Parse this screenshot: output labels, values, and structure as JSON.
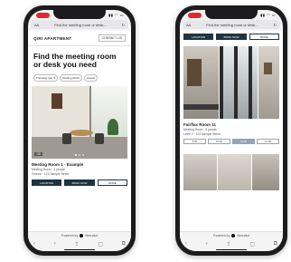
{
  "left_phone": {
    "url": "Find the meeting room or desk...",
    "status_icons": "▮▮ ◠ ▭",
    "brand": "QIRI APARTMENT",
    "contact_label": "CONTACT US",
    "hero_title": "Find the meeting room or desk you need",
    "chips": [
      "Thursday Dec 5",
      "Starting 09:00",
      "Guests"
    ],
    "photo_counter": "1/5",
    "room_title": "Meeting Room 1 - Example",
    "room_meta": [
      "Meeting Room · 4 people",
      "Ground · 123 Sample Street"
    ],
    "actions": [
      "LOCATION",
      "BOOK NOW",
      "MORE"
    ],
    "powered_by": "Powered by",
    "powered_brand": "Nexudus",
    "nav_icons": [
      "‹",
      "›",
      "⇪",
      "▢",
      "⧉"
    ]
  },
  "right_phone": {
    "url": "Find the meeting room or desk...",
    "status_icons": "▮▮ ◠ ▭",
    "top_actions": [
      "LOCATION",
      "BOOK NOW",
      "MORE"
    ],
    "room_title": "Fairflax Room 11",
    "room_meta": [
      "Meeting Room · 6 people",
      "Level 2 · 123 Sample Street"
    ],
    "slots": [
      "9:00",
      "10:00",
      "11:00",
      "12:00"
    ],
    "selected_slot_index": 2,
    "powered_by": "Powered by",
    "powered_brand": "Nexudus",
    "nav_icons": [
      "‹",
      "›",
      "⇪",
      "▢",
      "⧉"
    ]
  },
  "colors": {
    "accent_dark": "#1f3340",
    "recording": "#e5262e",
    "slot_selected": "#8fa7b8"
  }
}
